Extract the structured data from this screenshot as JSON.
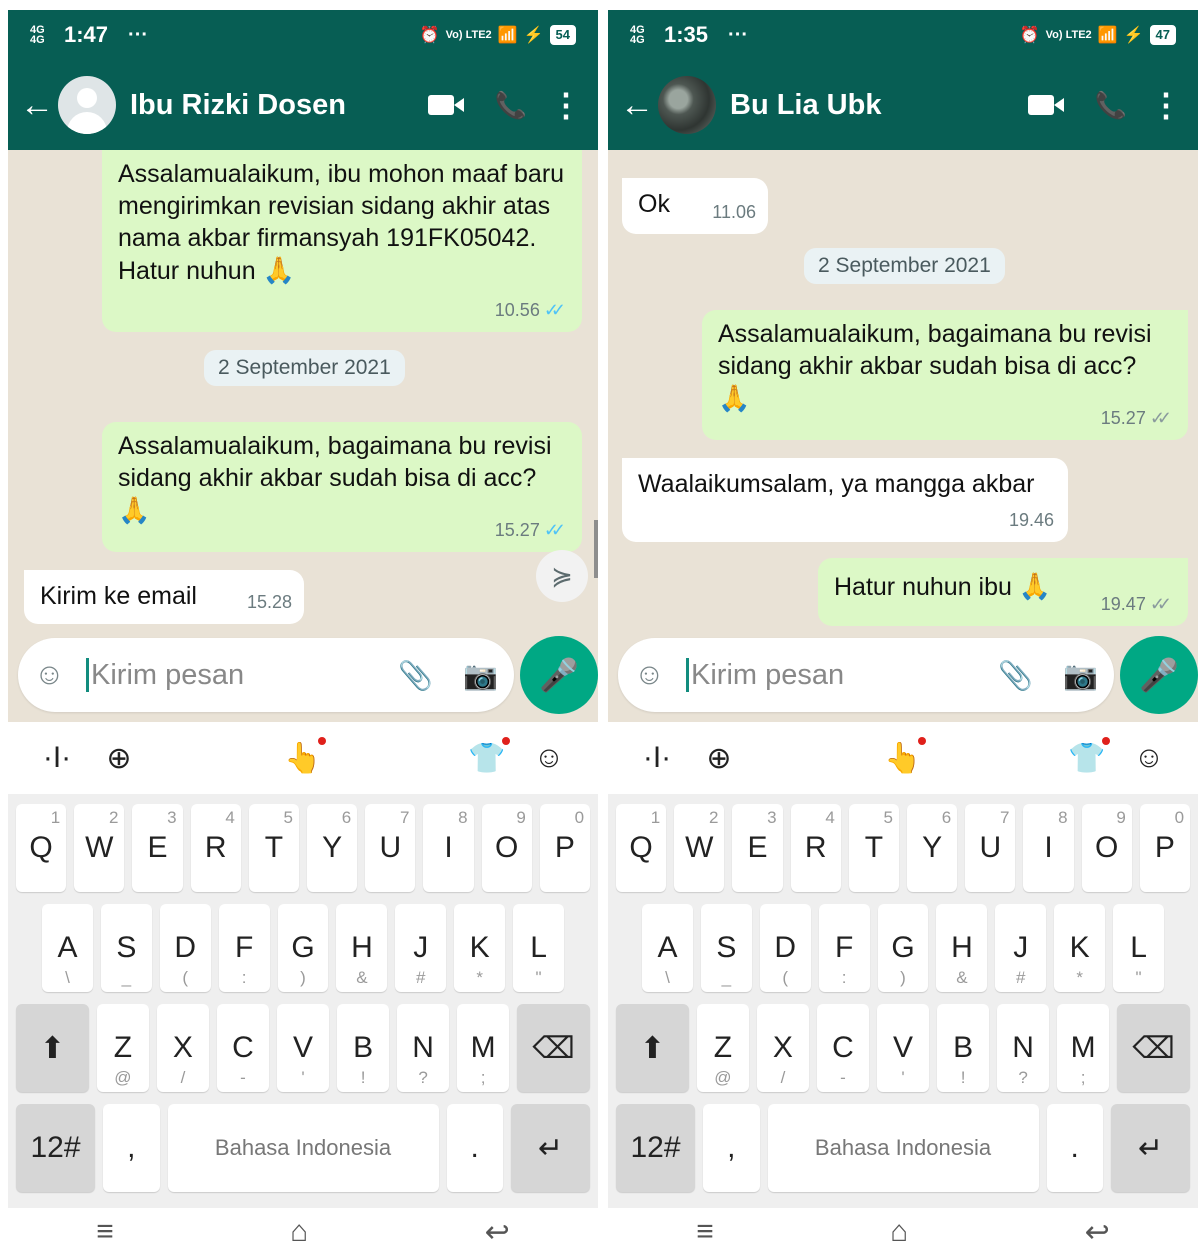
{
  "screens": [
    {
      "status": {
        "signal": "4G 4G",
        "time": "1:47",
        "dots": "···",
        "volte": "Vo) LTE2",
        "battery": "54"
      },
      "contact": {
        "name": "Ibu Rizki Dosen",
        "avatar": "default-avatar"
      },
      "messages": {
        "m1": {
          "text": "Assalamualaikum, ibu mohon maaf baru mengirimkan revisian sidang akhir atas nama akbar firmansyah 191FK05042. Hatur nuhun",
          "emoji": "🙏",
          "time": "10.56",
          "status": "read"
        },
        "date": "2 September 2021",
        "m2": {
          "text": "Assalamualaikum, bagaimana bu revisi sidang akhir akbar sudah bisa di acc?",
          "emoji": "🙏",
          "time": "15.27",
          "status": "read"
        },
        "m3": {
          "text": "Kirim ke email",
          "time": "15.28"
        }
      },
      "input": {
        "placeholder": "Kirim pesan"
      }
    },
    {
      "status": {
        "signal": "4G 4G",
        "time": "1:35",
        "dots": "···",
        "volte": "Vo) LTE2",
        "battery": "47"
      },
      "contact": {
        "name": "Bu Lia Ubk",
        "avatar": "photo-avatar"
      },
      "messages": {
        "m0": {
          "text": "Ok",
          "time": "11.06"
        },
        "date": "2 September 2021",
        "m1": {
          "text": "Assalamualaikum, bagaimana bu revisi sidang akhir akbar sudah bisa di acc?",
          "emoji": "🙏",
          "time": "15.27",
          "status": "delivered"
        },
        "m2": {
          "text": "Waalaikumsalam, ya mangga akbar",
          "time": "19.46"
        },
        "m3": {
          "text": "Hatur nuhun ibu",
          "emoji": "🙏",
          "time": "19.47",
          "status": "delivered"
        }
      },
      "input": {
        "placeholder": "Kirim pesan"
      }
    }
  ],
  "keyboard": {
    "row1": [
      {
        "k": "Q",
        "h": "1"
      },
      {
        "k": "W",
        "h": "2"
      },
      {
        "k": "E",
        "h": "3"
      },
      {
        "k": "R",
        "h": "4"
      },
      {
        "k": "T",
        "h": "5"
      },
      {
        "k": "Y",
        "h": "6"
      },
      {
        "k": "U",
        "h": "7"
      },
      {
        "k": "I",
        "h": "8"
      },
      {
        "k": "O",
        "h": "9"
      },
      {
        "k": "P",
        "h": "0"
      }
    ],
    "row2": [
      {
        "k": "A",
        "s": "\\"
      },
      {
        "k": "S",
        "s": "_"
      },
      {
        "k": "D",
        "s": "("
      },
      {
        "k": "F",
        "s": ":"
      },
      {
        "k": "G",
        "s": ")"
      },
      {
        "k": "H",
        "s": "&"
      },
      {
        "k": "J",
        "s": "#"
      },
      {
        "k": "K",
        "s": "*"
      },
      {
        "k": "L",
        "s": "\""
      }
    ],
    "row3": [
      {
        "k": "Z",
        "s": "@"
      },
      {
        "k": "X",
        "s": "/"
      },
      {
        "k": "C",
        "s": "-"
      },
      {
        "k": "V",
        "s": "'"
      },
      {
        "k": "B",
        "s": "!"
      },
      {
        "k": "N",
        "s": "?"
      },
      {
        "k": "M",
        "s": ";"
      }
    ],
    "symbols_key": "12#",
    "comma_key": ",",
    "space_label": "Bahasa Indonesia",
    "period_key": ".",
    "enter_glyph": "↵",
    "shift_glyph": "⬆",
    "backspace_glyph": "⌫"
  },
  "colors": {
    "header": "#075e54",
    "outgoing": "#dcf8c6",
    "incoming": "#ffffff",
    "accent": "#00a884"
  }
}
